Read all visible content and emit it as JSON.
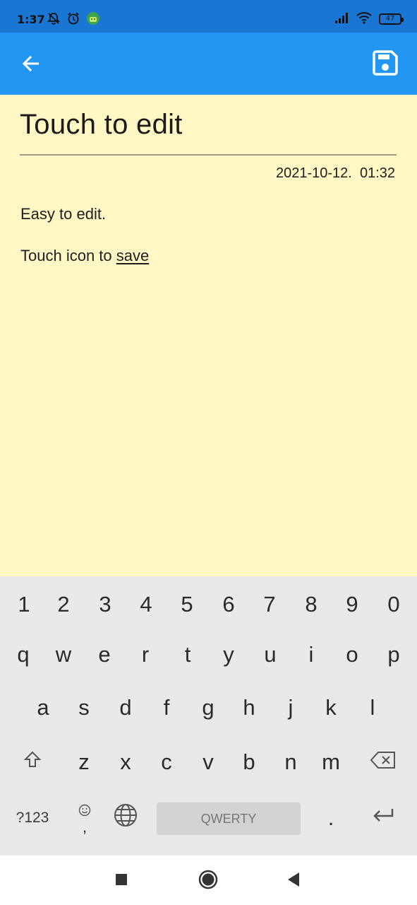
{
  "status_bar": {
    "time": "1:37",
    "battery": "47",
    "icons": [
      "mute-notification-icon",
      "alarm-icon",
      "android-icon",
      "signal-icon",
      "wifi-icon",
      "battery-icon"
    ]
  },
  "app_bar": {
    "back_icon": "arrow-left-icon",
    "save_icon": "floppy-disk-icon",
    "colors": {
      "app_bar": "#2196f3",
      "status_bar": "#1976d2"
    }
  },
  "note": {
    "title": "Touch to edit",
    "date": "2021-10-12.  01:32",
    "line1": "Easy to edit.",
    "line2_prefix": "Touch icon to ",
    "line2_link": "save",
    "background": "#fff8c4"
  },
  "keyboard": {
    "row_numbers": [
      "1",
      "2",
      "3",
      "4",
      "5",
      "6",
      "7",
      "8",
      "9",
      "0"
    ],
    "row_top": [
      "q",
      "w",
      "e",
      "r",
      "t",
      "y",
      "u",
      "i",
      "o",
      "p"
    ],
    "row_middle": [
      "a",
      "s",
      "d",
      "f",
      "g",
      "h",
      "j",
      "k",
      "l"
    ],
    "row_bottom": [
      "z",
      "x",
      "c",
      "v",
      "b",
      "n",
      "m"
    ],
    "symbols_label": "?123",
    "emoji_comma": ",",
    "space_label": "QWERTY",
    "period": "."
  },
  "nav_bar": {
    "icons": [
      "recents-square-icon",
      "home-circle-icon",
      "back-triangle-icon"
    ]
  }
}
